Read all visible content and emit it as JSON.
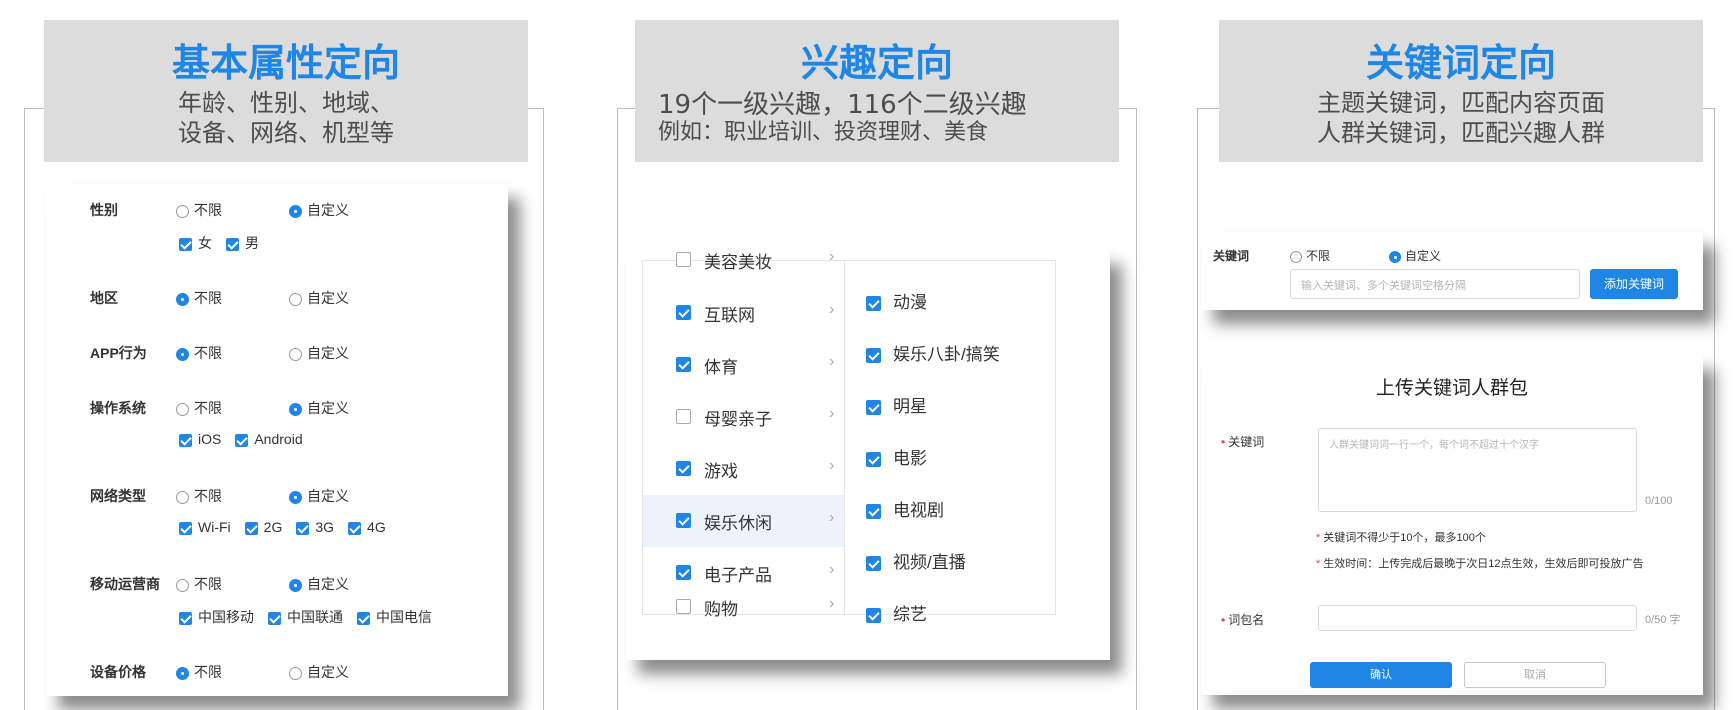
{
  "panel1": {
    "title": "基本属性定向",
    "sub1": "年龄、性别、地域、",
    "sub2": "设备、网络、机型等",
    "rows": [
      {
        "label": "性别",
        "opt1": "不限",
        "opt2": "自定义",
        "sub": [
          "女",
          "男"
        ]
      },
      {
        "label": "地区",
        "opt1": "不限",
        "opt2": "自定义"
      },
      {
        "label": "APP行为",
        "opt1": "不限",
        "opt2": "自定义"
      },
      {
        "label": "操作系统",
        "opt1": "不限",
        "opt2": "自定义",
        "sub": [
          "iOS",
          "Android"
        ]
      },
      {
        "label": "网络类型",
        "opt1": "不限",
        "opt2": "自定义",
        "sub": [
          "Wi-Fi",
          "2G",
          "3G",
          "4G"
        ]
      },
      {
        "label": "移动运营商",
        "opt1": "不限",
        "opt2": "自定义",
        "sub": [
          "中国移动",
          "中国联通",
          "中国电信"
        ]
      },
      {
        "label": "设备价格",
        "opt1": "不限",
        "opt2": "自定义"
      }
    ]
  },
  "panel2": {
    "title": "兴趣定向",
    "sub1": "19个一级兴趣，116个二级兴趣",
    "sub2": "例如：职业培训、投资理财、美食",
    "left": [
      "美容美妆",
      "互联网",
      "体育",
      "母婴亲子",
      "游戏",
      "娱乐休闲",
      "电子产品",
      "购物"
    ],
    "right": [
      "动漫",
      "娱乐八卦/搞笑",
      "明星",
      "电影",
      "电视剧",
      "视频/直播",
      "综艺"
    ],
    "arrow": "›"
  },
  "panel3": {
    "title": "关键词定向",
    "sub1": "主题关键词，匹配内容页面",
    "sub2": "人群关键词，匹配兴趣人群",
    "kw": {
      "label": "关键词",
      "opt1": "不限",
      "opt2": "自定义",
      "placeholder": "输入关键词、多个关键词空格分隔",
      "add": "添加关键词"
    },
    "upload": {
      "title": "上传关键词人群包",
      "req": "•",
      "kw_label": "关键词",
      "textarea_placeholder": "人群关键词词一行一个，每个词不超过十个汉字",
      "count": "0/100",
      "note_mark": "*",
      "note1": "关键词不得少于10个，最多100个",
      "note2": "生效时间：上传完成后最晚于次日12点生效，生效后即可投放广告",
      "pkg_label": "词包名",
      "pkg_count": "0/50 字",
      "ok": "确认",
      "cancel": "取消"
    }
  }
}
